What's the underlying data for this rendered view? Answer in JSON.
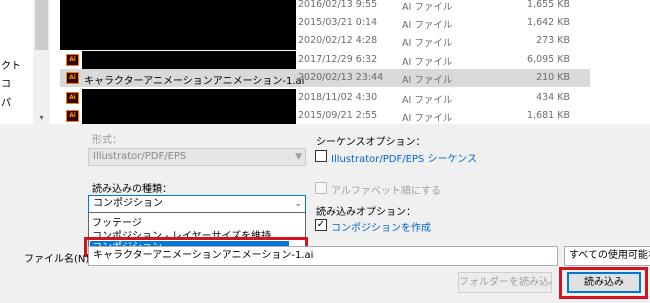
{
  "nav": {
    "items": [
      "クト",
      "コ",
      "パ"
    ],
    "scroll_down": "▾"
  },
  "files": [
    {
      "icon": "Ai",
      "name": "",
      "date": "2016/02/13 9:55",
      "type": "AI ファイル",
      "size": "1,655 KB",
      "redacted": true,
      "selected": false
    },
    {
      "icon": "Ai",
      "name": "",
      "date": "2015/03/21 0:14",
      "type": "AI ファイル",
      "size": "1,642 KB",
      "redacted": true,
      "selected": false
    },
    {
      "icon": "Ai",
      "name": "",
      "date": "2020/02/12 4:28",
      "type": "AI ファイル",
      "size": "273 KB",
      "redacted": true,
      "selected": false
    },
    {
      "icon": "Ai",
      "name": "",
      "date": "2017/12/29 6:32",
      "type": "AI ファイル",
      "size": "6,095 KB",
      "redacted": true,
      "selected": false
    },
    {
      "icon": "Ai",
      "name": "キャラクターアニメーションアニメーション-1.ai",
      "date": "2020/02/13 23:44",
      "type": "AI ファイル",
      "size": "210 KB",
      "redacted": false,
      "selected": true
    },
    {
      "icon": "Ai",
      "name": "",
      "date": "2018/11/02 4:30",
      "type": "AI ファイル",
      "size": "434 KB",
      "redacted": true,
      "selected": false
    },
    {
      "icon": "Ai",
      "name": "",
      "date": "2015/09/21 2:55",
      "type": "AI ファイル",
      "size": "1,681 KB",
      "redacted": true,
      "selected": false
    }
  ],
  "format": {
    "label": "形式：",
    "value": "Illustrator/PDF/EPS"
  },
  "sequence": {
    "label": "シーケンスオプション：",
    "checkbox_label": "Illustrator/PDF/EPS シーケンス",
    "alpha_label": "アルファベット順にする"
  },
  "import_type": {
    "label": "読み込みの種類：",
    "value": "コンポジション",
    "options": [
      "フッテージ",
      "コンポジション - レイヤーサイズを維持",
      "コンポジション"
    ],
    "highlighted_index": 2
  },
  "import_options": {
    "label": "読み込みオプション：",
    "create_comp_label": "コンポジションを作成",
    "create_comp_checked": "✓"
  },
  "filename": {
    "label": "ファイル名(N):",
    "value": "キャラクターアニメーションアニメーション-1.ai"
  },
  "filetype": {
    "value": "すべての使用可能な"
  },
  "buttons": {
    "import_folder": "フォルダーを読み込み",
    "import": "読み込み"
  },
  "colors": {
    "highlight_red": "#d5131e",
    "selection_blue": "#0078d7",
    "link_blue": "#0066cc"
  }
}
